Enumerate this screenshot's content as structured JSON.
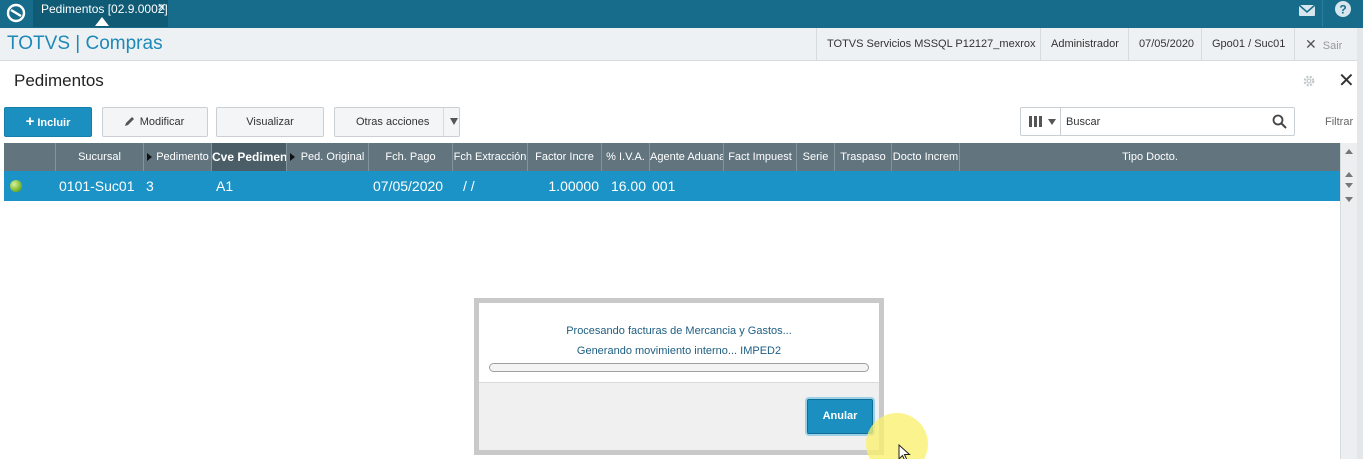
{
  "topbar": {
    "tab_label": "Pedimentos [02.9.0002]",
    "tab_close": "✕",
    "icons": [
      "app-logo-icon",
      "mail-icon",
      "help-icon"
    ]
  },
  "header": {
    "brand": "TOTVS | Compras",
    "environment": "TOTVS Servicios MSSQL P12127_mexrox",
    "user": "Administrador",
    "date": "07/05/2020",
    "company": "Gpo01 / Suc01",
    "logout_label": "Sair"
  },
  "page": {
    "title": "Pedimentos"
  },
  "toolbar": {
    "include_label": "Incluir",
    "modify_label": "Modificar",
    "view_label": "Visualizar",
    "other_actions_label": "Otras acciones",
    "search_placeholder": "Buscar",
    "filter_label": "Filtrar"
  },
  "grid": {
    "columns": [
      "Sucursal",
      "Pedimento",
      "Cve Pedimento",
      "Ped. Original",
      "Fch. Pago",
      "Fch Extracción",
      "Factor Incre",
      "% I.V.A.",
      "Agente Aduanal",
      "Fact Impuest",
      "Serie",
      "Traspaso",
      "Docto Increm",
      "Tipo Docto."
    ],
    "rows": [
      {
        "status": "green",
        "sucursal": "0101-Suc01",
        "pedimento": "3",
        "cve_pedimento": "A1",
        "ped_original": "",
        "fch_pago": "07/05/2020",
        "fch_extraccion": "/ /",
        "factor_incre": "1.00000",
        "iva": "16.00",
        "agente_aduanal": "001",
        "fact_impuest": "",
        "serie": "",
        "traspaso": "",
        "docto_increm": "",
        "tipo_docto": ""
      }
    ]
  },
  "dialog": {
    "line1": "Procesando facturas de Mercancia y Gastos...",
    "line2": "Generando movimiento interno... IMPED2",
    "progress": 0,
    "cancel_label": "Anular"
  },
  "colors": {
    "topbar": "#176c8b",
    "brand": "#1d89b8",
    "accent": "#1a8fc0",
    "grid_header": "#62757f",
    "selected_row": "#1b93c6"
  }
}
